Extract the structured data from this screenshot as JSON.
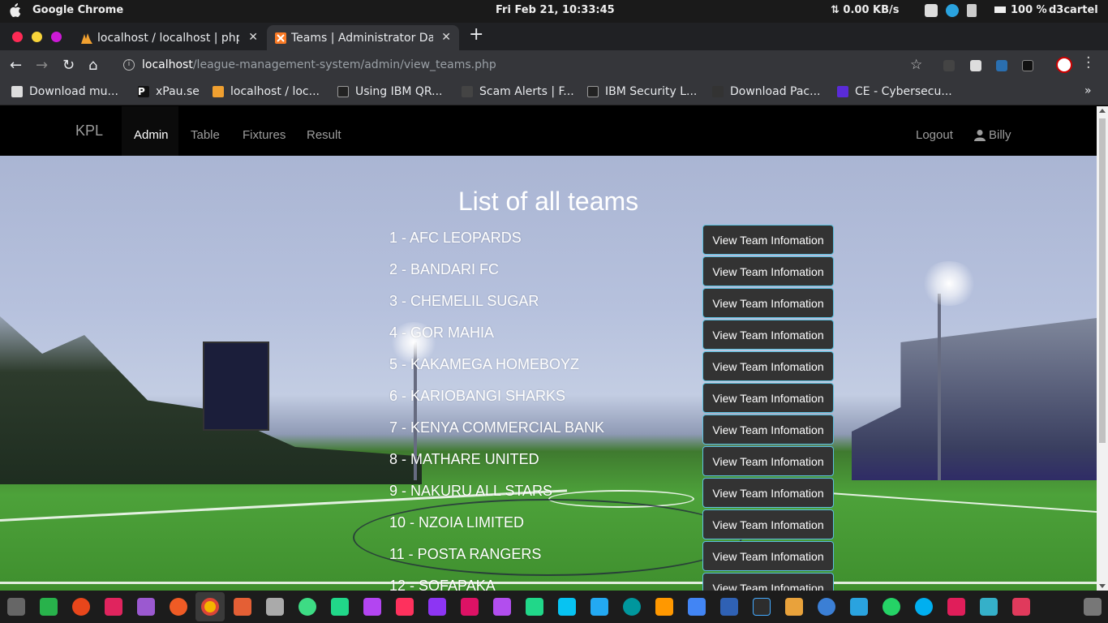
{
  "os": {
    "app_name": "Google Chrome",
    "clock": "Fri Feb 21, 10:33:45",
    "network": "⇅ 0.00 KB/s",
    "battery": "100 %",
    "user": "d3cartel"
  },
  "tabs": [
    {
      "title": "localhost / localhost | php",
      "active": false
    },
    {
      "title": "Teams | Administrator Da",
      "active": true
    }
  ],
  "toolbar": {
    "url_host": "localhost",
    "url_path": "/league-management-system/admin/view_teams.php"
  },
  "bookmarks": [
    "Download mu...",
    "xPau.se",
    "localhost / loc...",
    "Using IBM QR...",
    "Scam Alerts | F...",
    "IBM Security L...",
    "Download Pac...",
    "CE - Cybersecu..."
  ],
  "bookmarks_more": "»",
  "site": {
    "brand": "KPL",
    "nav": [
      "Admin",
      "Table",
      "Fixtures",
      "Result"
    ],
    "active_nav": "Admin",
    "logout": "Logout",
    "username": "Billy",
    "page_title": "List of all teams",
    "button_label": "View Team Infomation",
    "teams": [
      "1 - AFC LEOPARDS",
      "2 - BANDARI FC",
      "3 - CHEMELIL SUGAR",
      "4 - GOR MAHIA",
      "5 - KAKAMEGA HOMEBOYZ",
      "6 - KARIOBANGI SHARKS",
      "7 - KENYA COMMERCIAL BANK",
      "8 - MATHARE UNITED",
      "9 - NAKURU ALL STARS",
      "10 - NZOIA LIMITED",
      "11 - POSTA RANGERS",
      "12 - SOFAPAKA"
    ]
  }
}
